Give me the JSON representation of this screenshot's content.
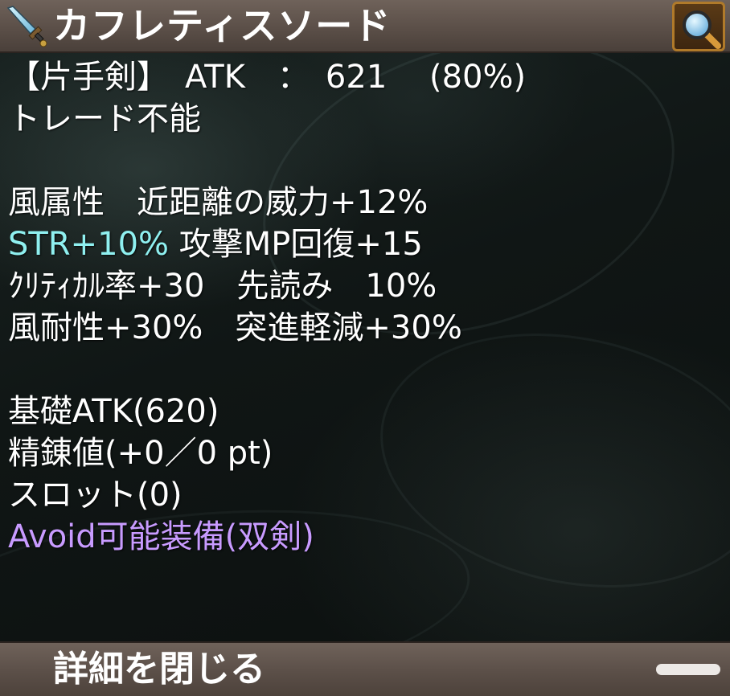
{
  "header": {
    "item_name": "カフレティスソード",
    "icon": "sword-icon",
    "zoom_icon": "magnifier-icon"
  },
  "info": {
    "type_line": "【片手剣】　ATK　：　621　 (80%)",
    "trade_line": "トレード不能",
    "stats": [
      "風属性　近距離の威力+12%",
      "STR+10%",
      " 攻撃MP回復+15",
      "ｸﾘﾃｨｶﾙ率+30　先読み　10%",
      "風耐性+30%　突進軽減+30%"
    ],
    "base_atk": "基礎ATK(620)",
    "refine": "精錬値(+0／0 pt)",
    "slot": "スロット(0)",
    "avoid": "Avoid可能装備(双剣)"
  },
  "footer": {
    "close_label": "詳細を閉じる"
  },
  "colors": {
    "highlight_stat": "#8ff0f0",
    "avoid_text": "#c89bff",
    "bar_bg": "#5b4f48",
    "zoom_border": "#b07a2a"
  }
}
